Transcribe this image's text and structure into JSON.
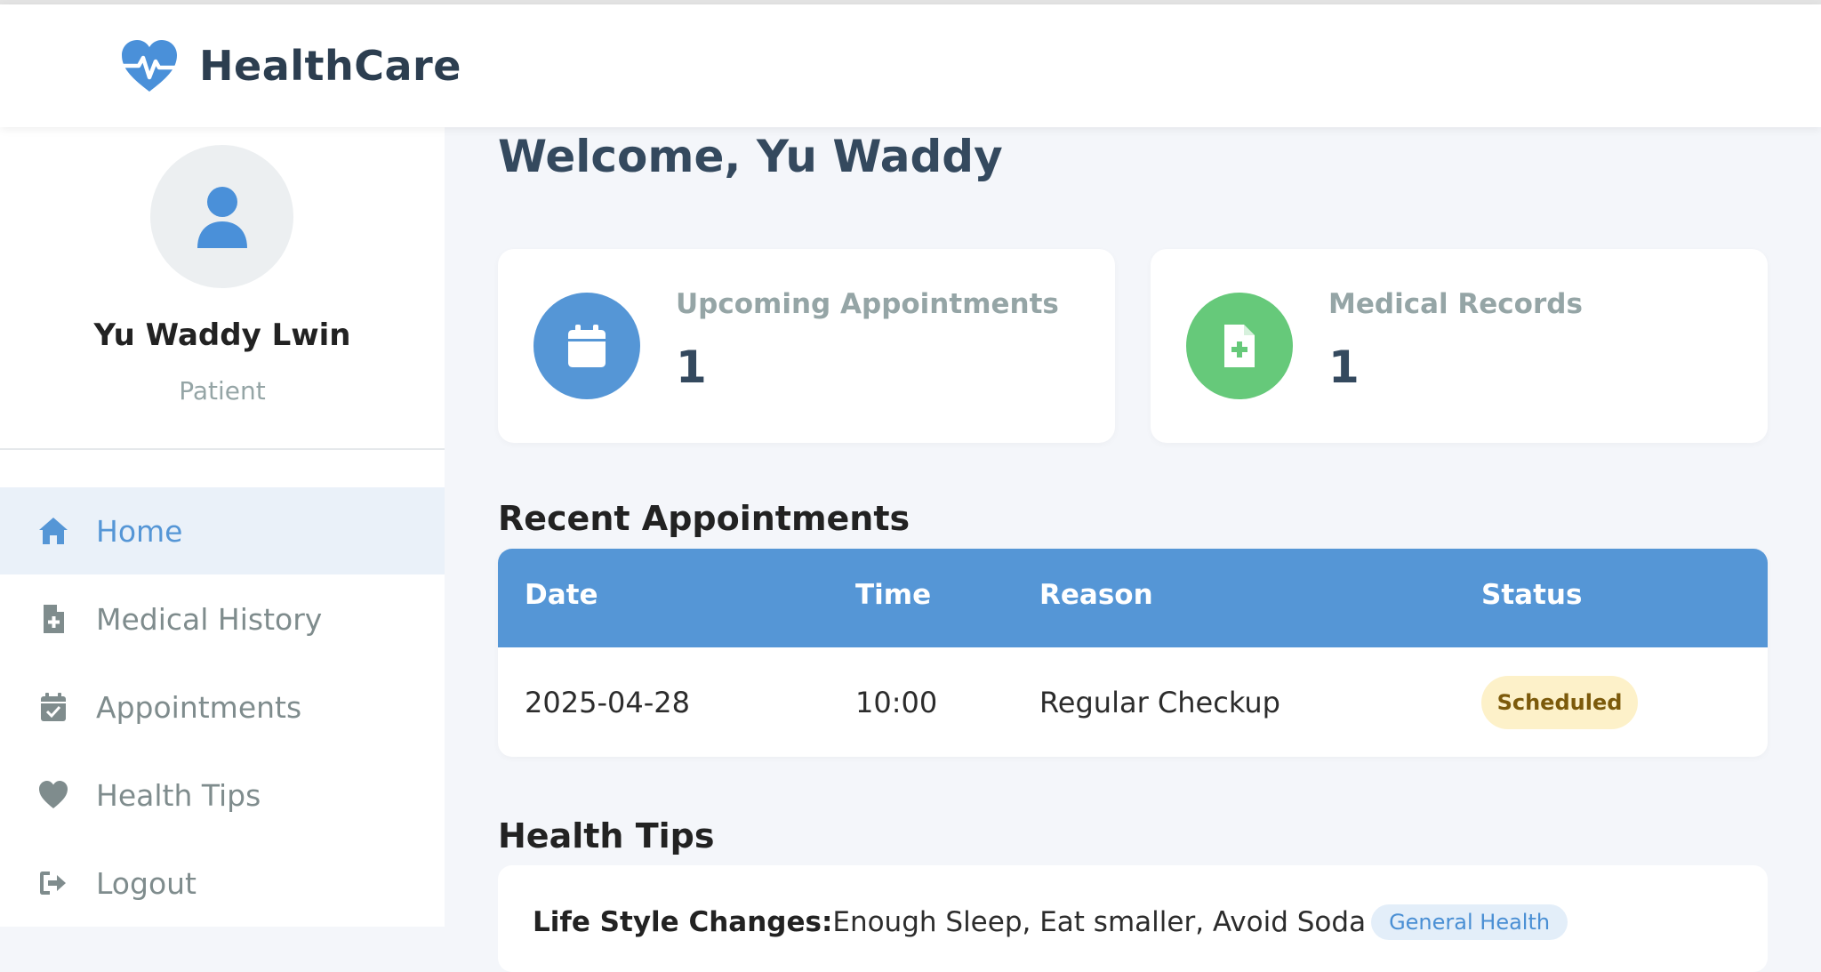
{
  "app": {
    "brand_name": "HealthCare",
    "brand_icon": "heart-pulse-icon",
    "accent_color": "#5596d6"
  },
  "sidebar": {
    "profile": {
      "avatar_icon": "user-icon",
      "name": "Yu Waddy Lwin",
      "role": "Patient"
    },
    "items": [
      {
        "label": "Home",
        "icon": "home-icon",
        "active": true
      },
      {
        "label": "Medical History",
        "icon": "file-medical-icon",
        "active": false
      },
      {
        "label": "Appointments",
        "icon": "calendar-check-icon",
        "active": false
      },
      {
        "label": "Health Tips",
        "icon": "heart-icon",
        "active": false
      },
      {
        "label": "Logout",
        "icon": "sign-out-icon",
        "active": false
      }
    ]
  },
  "main": {
    "welcome": "Welcome, Yu Waddy",
    "stats": [
      {
        "label": "Upcoming Appointments",
        "value": "1",
        "icon": "calendar-icon",
        "color": "#5596d6"
      },
      {
        "label": "Medical Records",
        "value": "1",
        "icon": "file-medical-icon",
        "color": "#66c97a"
      }
    ],
    "recent_appointments": {
      "title": "Recent Appointments",
      "columns": [
        "Date",
        "Time",
        "Reason",
        "Status"
      ],
      "rows": [
        {
          "date": "2025-04-28",
          "time": "10:00",
          "reason": "Regular Checkup",
          "status": "Scheduled",
          "status_color": "#fdf1c9"
        }
      ]
    },
    "health_tips": {
      "title": "Health Tips",
      "items": [
        {
          "title": "Life Style Changes:",
          "text": "Enough Sleep, Eat smaller, Avoid Soda",
          "tag": "General Health"
        }
      ]
    }
  }
}
